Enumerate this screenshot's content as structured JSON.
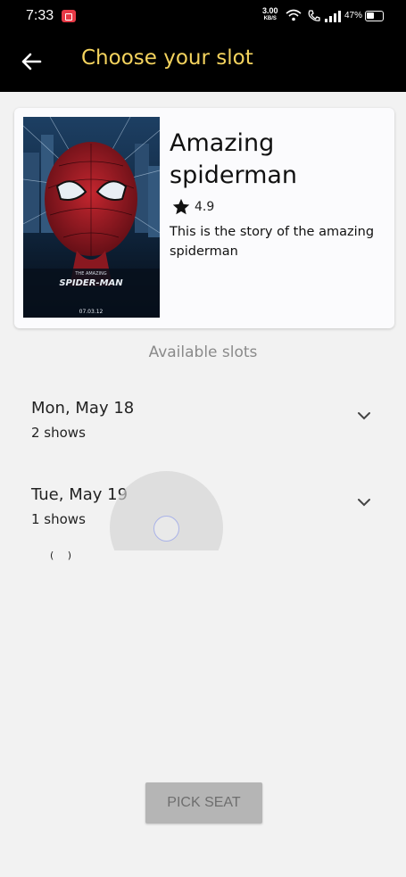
{
  "status_bar": {
    "time": "7:33",
    "net_speed": "3.00",
    "net_unit": "KB/S",
    "battery": "47%"
  },
  "app_bar": {
    "title": "Choose your slot",
    "back_icon": "arrow-left-icon",
    "title_color": "#f4d35e"
  },
  "movie": {
    "title": "Amazing spiderman",
    "rating": "4.9",
    "description": "This is the story of the amazing spiderman",
    "poster": {
      "logo_line1": "THE AMAZING",
      "logo_line2": "SPIDER-MAN",
      "release_date": "07.03.12"
    }
  },
  "slots": {
    "heading": "Available slots",
    "items": [
      {
        "date": "Mon, May 18",
        "shows": "2 shows"
      },
      {
        "date": "Tue, May 19",
        "shows": "1 shows"
      }
    ]
  },
  "loading": {
    "marks": "( )"
  },
  "footer": {
    "pick_seat_label": "PICK SEAT"
  }
}
